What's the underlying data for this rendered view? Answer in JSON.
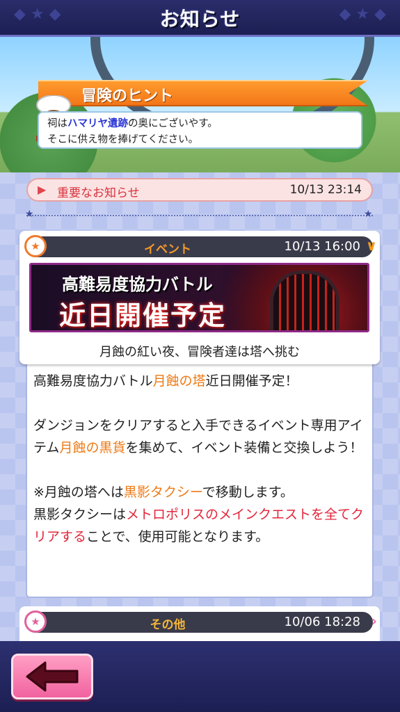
{
  "header": {
    "title": "お知らせ"
  },
  "hint": {
    "title": "冒険のヒント",
    "line1_pre": "祠は",
    "line1_place": "ハマリヤ遺跡",
    "line1_post": "の奥にございやす。",
    "line2": "そこに供え物を捧げてください。"
  },
  "important": {
    "label": "重要なお知らせ",
    "date": "10/13 23:14"
  },
  "notices": [
    {
      "category": "イベント",
      "date": "10/13 16:00",
      "banner_line1": "高難易度協力バトル",
      "banner_line2": "近日開催予定",
      "subtitle": "月蝕の紅い夜、冒険者達は塔へ挑む"
    },
    {
      "category": "その他",
      "date": "10/06 18:28"
    }
  ],
  "body": {
    "p1_pre": "高難易度協力バトル",
    "p1_hl": "月蝕の塔",
    "p1_post": "近日開催予定！",
    "p2_pre": "ダンジョンをクリアすると入手できるイベント専用アイテム",
    "p2_hl": "月蝕の黒貨",
    "p2_post": "を集めて、イベント装備と交換しよう！",
    "p3_pre": "※月蝕の塔へは",
    "p3_hl": "黒影タクシー",
    "p3_post": "で移動します。",
    "p4_pre": "黒影タクシーは",
    "p4_hl": "メトロポリスのメインクエストを全てクリアする",
    "p4_post": "ことで、使用可能となります。"
  },
  "icons": {
    "back": "back-arrow-icon",
    "event_badge": "star-badge-icon",
    "expand": "chevron-down-icon",
    "open": "chevron-right-icon"
  },
  "colors": {
    "accent_orange": "#f37617",
    "highlight_red": "#e2253a",
    "highlight_blue": "#2a36d6",
    "navy": "#1c1f52"
  }
}
